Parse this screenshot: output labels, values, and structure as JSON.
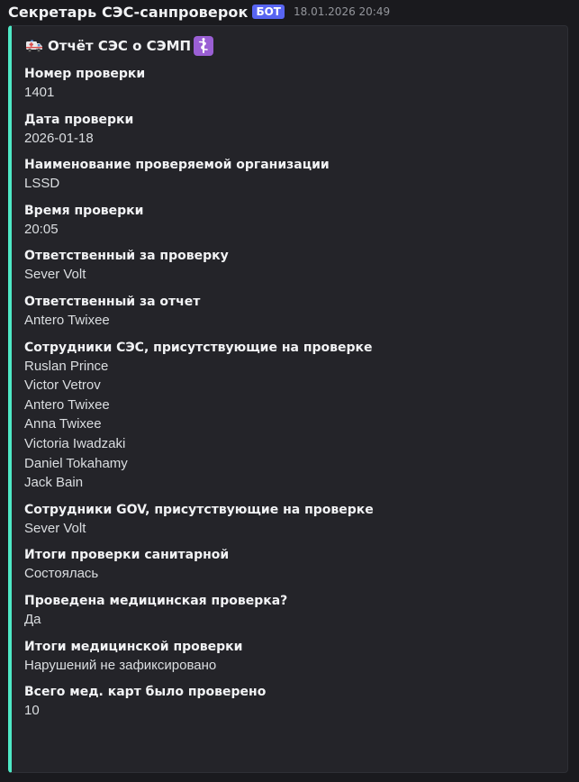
{
  "message": {
    "author": "Секретарь СЭС-санпроверок",
    "badge": "БОТ",
    "timestamp": "18.01.2026 20:49"
  },
  "embed": {
    "accent_color": "#4ee8c5",
    "title_icons": [
      "ambulance-icon",
      "medical-symbol-icon"
    ],
    "title": "Отчёт СЭС о СЭМП",
    "fields": [
      {
        "name": "Номер проверки",
        "value": "1401"
      },
      {
        "name": "Дата проверки",
        "value": "2026-01-18"
      },
      {
        "name": "Наименование проверяемой организации",
        "value": "LSSD"
      },
      {
        "name": "Время проверки",
        "value": "20:05"
      },
      {
        "name": "Ответственный за проверку",
        "value": "Sever Volt"
      },
      {
        "name": "Ответственный за отчет",
        "value": "Antero Twixee"
      },
      {
        "name": "Сотрудники СЭС, присутствующие на проверке",
        "lines": [
          "Ruslan Prince",
          "Victor Vetrov",
          "Antero Twixee",
          "Anna Twixee",
          "Victoria Iwadzaki",
          "Daniel Tokahamy",
          "Jack Bain"
        ]
      },
      {
        "name": "Сотрудники GOV, присутствующие на проверке",
        "value": "Sever Volt"
      },
      {
        "name": "Итоги проверки санитарной",
        "value": "Состоялась"
      },
      {
        "name": "Проведена медицинская проверка?",
        "value": "Да"
      },
      {
        "name": "Итоги медицинской проверки",
        "value": "Нарушений не зафиксировано"
      },
      {
        "name": "Всего мед. карт было проверено",
        "value": "10"
      }
    ]
  }
}
